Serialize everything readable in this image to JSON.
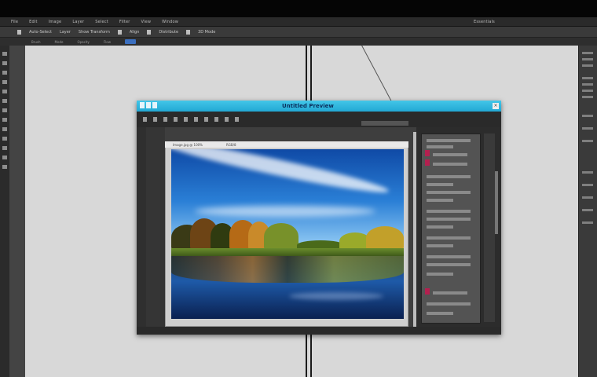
{
  "app": {
    "menubar": [
      "File",
      "Edit",
      "Image",
      "Layer",
      "Select",
      "Filter",
      "View",
      "Window"
    ],
    "menubar_right": "Essentials",
    "options": [
      "Auto-Select",
      "Layer",
      "Show Transform",
      "Align",
      "Distribute",
      "3D Mode"
    ],
    "options2": [
      "Brush",
      "Mode",
      "Opacity",
      "Flow"
    ]
  },
  "window": {
    "title": "Untitled Preview",
    "close_label": "×"
  },
  "document": {
    "tab_label": "Image.jpg @ 100%",
    "tab_label2": "RGB/8",
    "photo_desc_icon": "landscape-photo"
  },
  "colors": {
    "titlebar": "#22a8d4",
    "accent_red": "#b3204f",
    "chrome_dark": "#2a2a2a"
  }
}
